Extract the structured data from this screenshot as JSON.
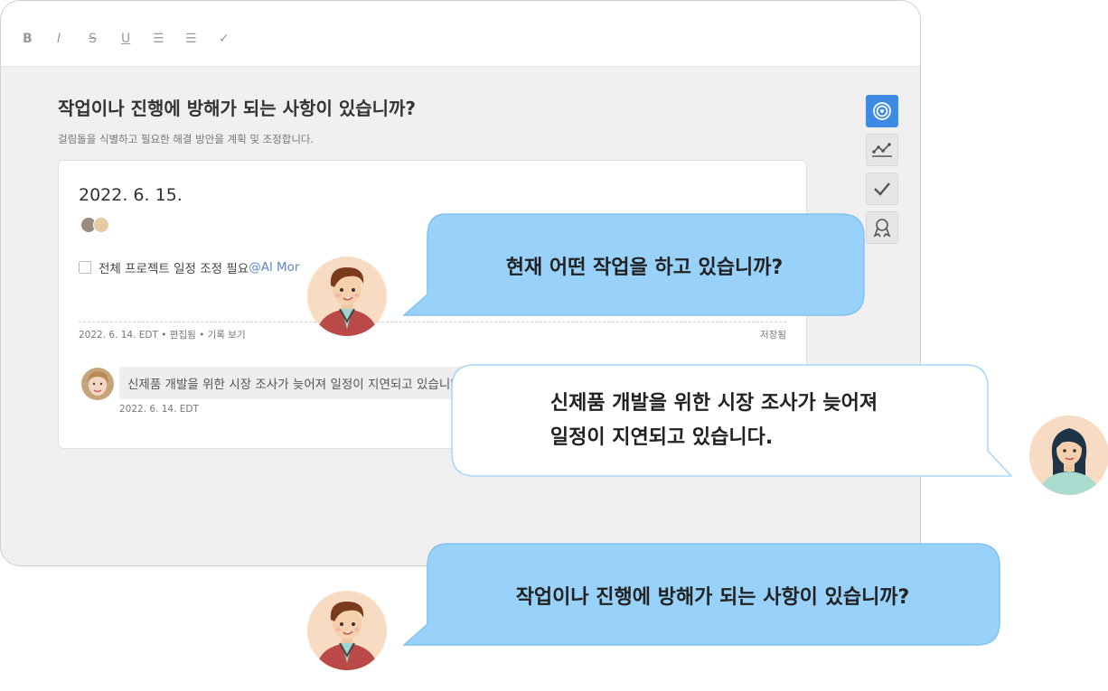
{
  "toolbar": {
    "bold": "B",
    "italic": "I",
    "strike": "S",
    "underline": "U",
    "bullet_list": "☰",
    "numbered_list": "☰",
    "check": "✓"
  },
  "question": {
    "title": "작업이나 진행에 방해가 되는 사항이 있습니까?",
    "subtitle": "걸림돌을 식별하고 필요한 해결 방안을 계획 및 조정합니다."
  },
  "side_rail": [
    {
      "icon": "target-icon",
      "active": true
    },
    {
      "icon": "chart-line-icon",
      "active": false
    },
    {
      "icon": "check-icon",
      "active": false
    },
    {
      "icon": "award-icon",
      "active": false
    }
  ],
  "entry": {
    "date": "2022. 6. 15.",
    "task_text": "전체 프로젝트 일정 조정 필요",
    "task_mention": "@Al Mor",
    "meta": "2022. 6. 14. EDT • 편집됨 • 기록 보기",
    "saved": "저장됨"
  },
  "comment": {
    "text": "신제품 개발을 위한 시장 조사가 늦어져 일정이 지연되고 있습니다.",
    "date": "2022. 6. 14. EDT"
  },
  "bubbles": {
    "first": "현재 어떤 작업을 하고 있습니까?",
    "second_line1": "신제품 개발을 위한 시장 조사가 늦어져",
    "second_line2": "일정이 지연되고 있습니다.",
    "third": "작업이나 진행에 방해가 되는 사항이 있습니까?"
  },
  "colors": {
    "bubble_blue": "#98d2fa",
    "bubble_white": "#ffffff",
    "accent": "#3d8be4"
  }
}
